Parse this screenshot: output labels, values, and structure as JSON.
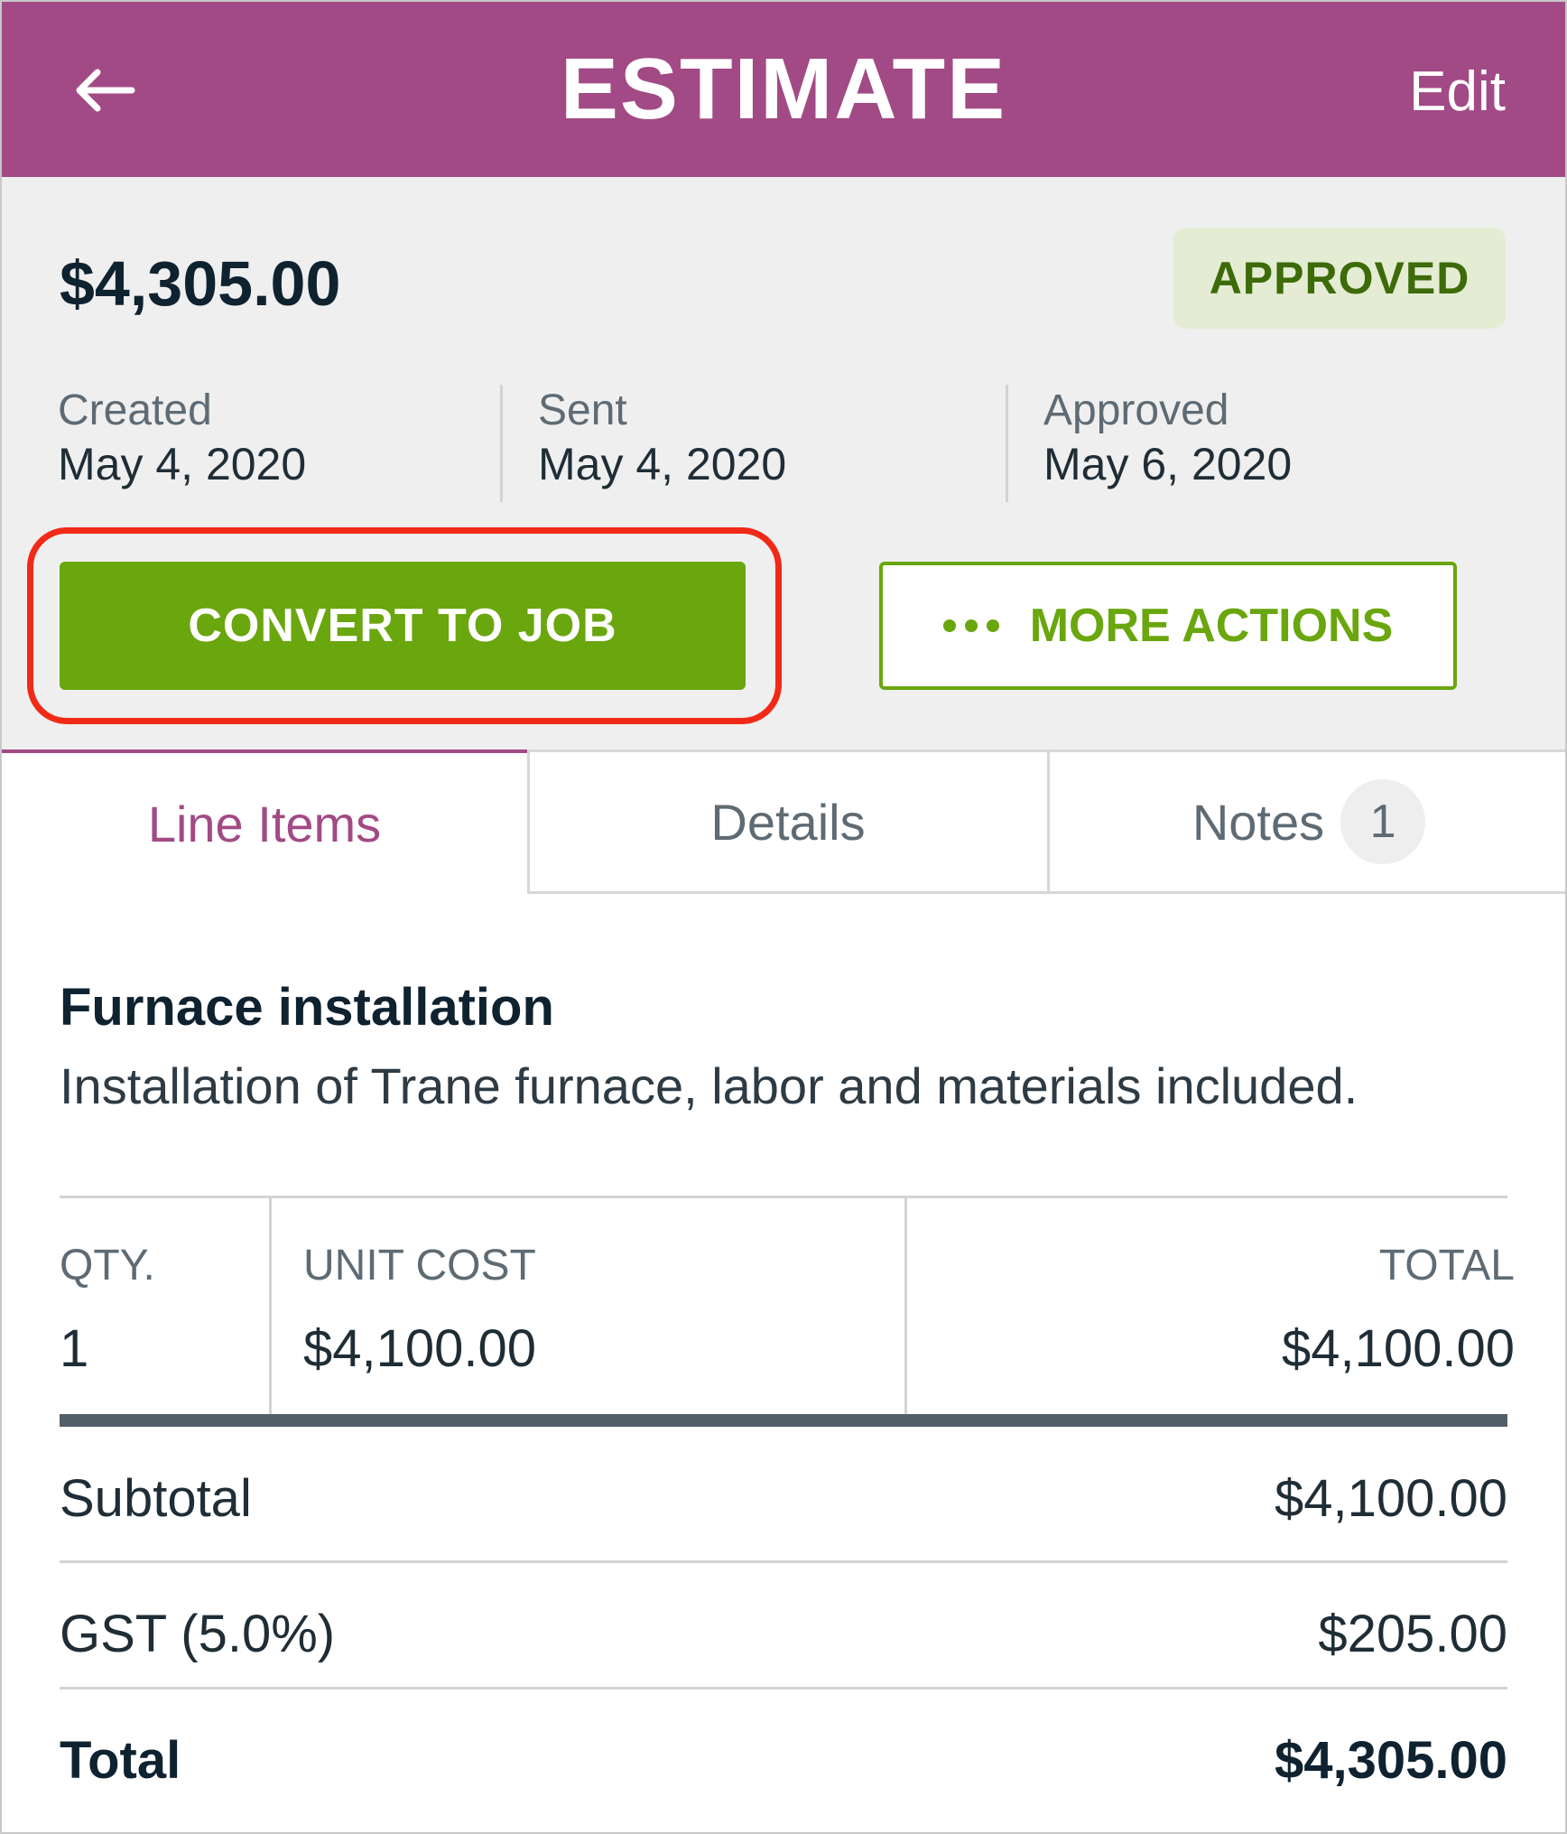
{
  "header": {
    "title": "ESTIMATE",
    "edit_label": "Edit",
    "back_icon": "arrow-left-icon"
  },
  "summary": {
    "amount": "$4,305.00",
    "status": "APPROVED",
    "dates": [
      {
        "label": "Created",
        "value": "May 4, 2020"
      },
      {
        "label": "Sent",
        "value": "May 4, 2020"
      },
      {
        "label": "Approved",
        "value": "May 6, 2020"
      }
    ],
    "convert_label": "CONVERT TO JOB",
    "more_label": "MORE ACTIONS"
  },
  "tabs": [
    {
      "label": "Line Items",
      "active": true
    },
    {
      "label": "Details",
      "active": false
    },
    {
      "label": "Notes",
      "active": false,
      "count": "1"
    }
  ],
  "line_item": {
    "name": "Furnace installation",
    "description": "Installation of Trane furnace, labor and materials included.",
    "columns": {
      "qty": "QTY.",
      "unit_cost": "UNIT COST",
      "total": "TOTAL"
    },
    "values": {
      "qty": "1",
      "unit_cost": "$4,100.00",
      "total": "$4,100.00"
    }
  },
  "totals": {
    "subtotal_label": "Subtotal",
    "subtotal_value": "$4,100.00",
    "tax_label": "GST (5.0%)",
    "tax_value": "$205.00",
    "total_label": "Total",
    "total_value": "$4,305.00"
  },
  "colors": {
    "brand": "#a24a85",
    "accent_green": "#6aa60e",
    "highlight": "#f02a17"
  }
}
